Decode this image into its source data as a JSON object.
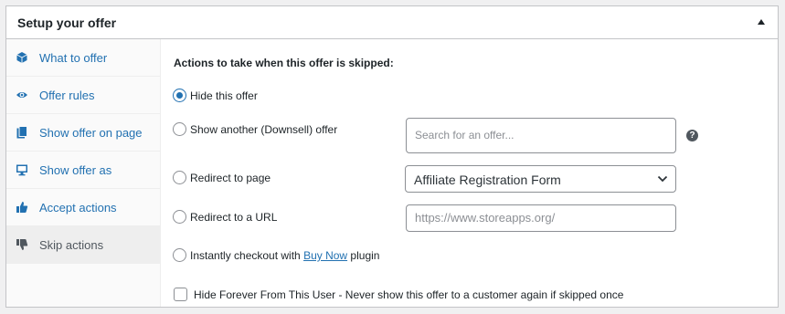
{
  "panel": {
    "title": "Setup your offer"
  },
  "tabs": [
    {
      "label": "What to offer",
      "icon": "cube-icon"
    },
    {
      "label": "Offer rules",
      "icon": "eye-icon"
    },
    {
      "label": "Show offer on page",
      "icon": "page-icon"
    },
    {
      "label": "Show offer as",
      "icon": "monitor-icon"
    },
    {
      "label": "Accept actions",
      "icon": "thumbs-up-icon"
    },
    {
      "label": "Skip actions",
      "icon": "thumbs-down-icon",
      "active": true
    }
  ],
  "skip": {
    "title": "Actions to take when this offer is skipped:",
    "hide_label": "Hide this offer",
    "downsell_label": "Show another (Downsell) offer",
    "search_placeholder": "Search for an offer...",
    "help_glyph": "?",
    "redirect_page_label": "Redirect to page",
    "redirect_page_value": "Affiliate Registration Form",
    "redirect_url_label": "Redirect to a URL",
    "url_placeholder": "https://www.storeapps.org/",
    "checkout_prefix": "Instantly checkout with ",
    "checkout_link": "Buy Now",
    "checkout_suffix": " plugin",
    "hide_forever_label": "Hide Forever From This User - Never show this offer to a customer again if skipped once"
  },
  "colors": {
    "accent": "#2271b1",
    "text": "#1d2327",
    "border": "#c3c4c7"
  }
}
